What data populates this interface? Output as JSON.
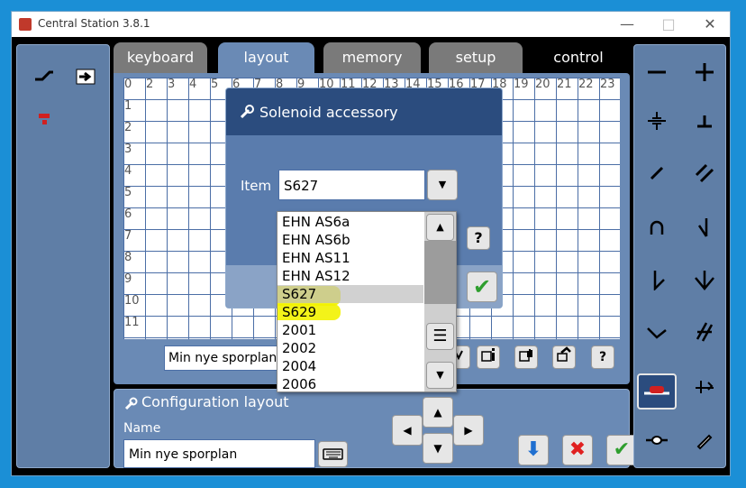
{
  "window": {
    "title": "Central Station 3.8.1",
    "controls": [
      "—",
      "□",
      "✕"
    ]
  },
  "tabs": [
    {
      "label": "keyboard",
      "state": "inactive"
    },
    {
      "label": "layout",
      "state": "active"
    },
    {
      "label": "memory",
      "state": "inactive"
    },
    {
      "label": "setup",
      "state": "inactive"
    },
    {
      "label": "control",
      "state": "dark"
    }
  ],
  "grid": {
    "columns": [
      "0",
      "2",
      "3",
      "4",
      "5",
      "6",
      "7",
      "8",
      "9",
      "10",
      "11",
      "12",
      "13",
      "14",
      "15",
      "16",
      "17",
      "18",
      "19",
      "20",
      "21",
      "22",
      "23"
    ],
    "rows": [
      "1",
      "2",
      "3",
      "4",
      "5",
      "6",
      "7",
      "8",
      "9",
      "10",
      "11"
    ]
  },
  "layout_bar": {
    "plan_name": "Min nye sporplan"
  },
  "dialog": {
    "title": "Solenoid accessory",
    "item_label": "Item",
    "item_value": "S627",
    "help_label": "?",
    "ok_label": "✔"
  },
  "dropdown": {
    "options": [
      "EHN AS6a",
      "EHN AS6b",
      "EHN AS11",
      "EHN AS12",
      "S627",
      "S629",
      "2001",
      "2002",
      "2004",
      "2006"
    ],
    "selected": "S627"
  },
  "config": {
    "title": "Configuration layout",
    "name_label": "Name",
    "name_value": "Min nye sporplan"
  },
  "buttons": {
    "help": "?",
    "down": "⬇",
    "cancel": "✖",
    "ok": "✔",
    "up_arrow": "▲",
    "down_arrow": "▼",
    "left_arrow": "◀",
    "right_arrow": "▶",
    "caret": "▼",
    "scroll_up": "▲",
    "scroll_down": "▼",
    "scroll_menu": "☰"
  },
  "colors": {
    "accent_green": "#2e9e2e",
    "cancel_red": "#e02020",
    "down_blue": "#1f6fd0",
    "highlight": "#f2f200"
  }
}
